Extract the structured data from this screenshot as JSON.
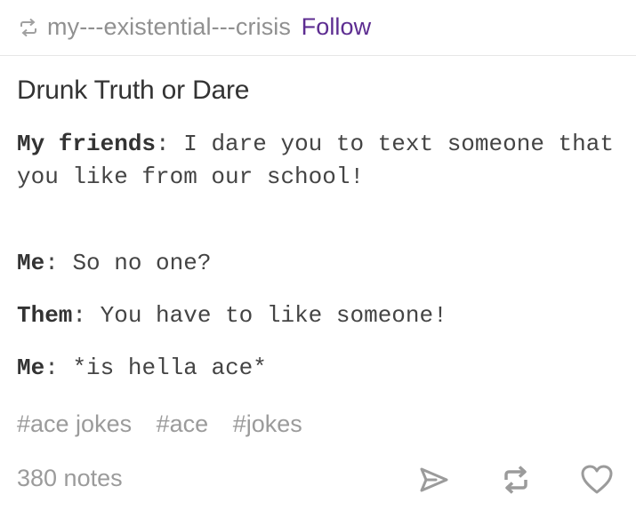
{
  "post": {
    "reblog_source": "my---existential---crisis",
    "follow_label": "Follow",
    "title": "Drunk Truth or Dare",
    "dialogue": [
      {
        "speaker": "My friends",
        "text": "I dare you to text someone that you like from our school!"
      },
      {
        "speaker": "Me",
        "text": "So no one?"
      },
      {
        "speaker": "Them",
        "text": "You have to like someone!"
      },
      {
        "speaker": "Me",
        "text": "*is hella ace*"
      }
    ],
    "tags": [
      "#ace jokes",
      "#ace",
      "#jokes"
    ],
    "notes": "380 notes"
  },
  "icons": {
    "reblog_header": "reblog-icon",
    "share": "paper-plane-icon",
    "reblog": "reblog-icon",
    "like": "heart-icon"
  },
  "colors": {
    "follow": "#5d2d91",
    "muted": "#9b9b9b",
    "text": "#444444"
  }
}
